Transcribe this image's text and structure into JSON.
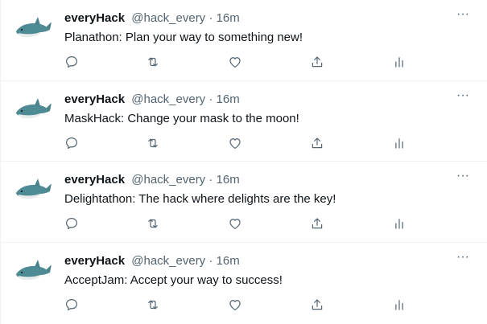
{
  "tweets": [
    {
      "display_name": "everyHack",
      "handle": "@hack_every",
      "separator": "·",
      "time": "16m",
      "text": "Planathon: Plan your way to something new!",
      "more_label": "···"
    },
    {
      "display_name": "everyHack",
      "handle": "@hack_every",
      "separator": "·",
      "time": "16m",
      "text": "MaskHack: Change your mask to the moon!",
      "more_label": "···"
    },
    {
      "display_name": "everyHack",
      "handle": "@hack_every",
      "separator": "·",
      "time": "16m",
      "text": "Delightathon: The hack where delights are the key!",
      "more_label": "···"
    },
    {
      "display_name": "everyHack",
      "handle": "@hack_every",
      "separator": "·",
      "time": "16m",
      "text": "AcceptJam: Accept your way to success!",
      "more_label": "···"
    }
  ],
  "icons": {
    "avatar": "shark-plush-avatar",
    "more": "more-horizontal-icon",
    "reply": "reply-icon",
    "retweet": "retweet-icon",
    "like": "heart-icon",
    "share": "share-icon",
    "analytics": "analytics-icon"
  },
  "colors": {
    "text_primary": "#0f1419",
    "text_secondary": "#536471",
    "divider": "#eff3f4",
    "avatar_shark": "#4f8b95"
  }
}
